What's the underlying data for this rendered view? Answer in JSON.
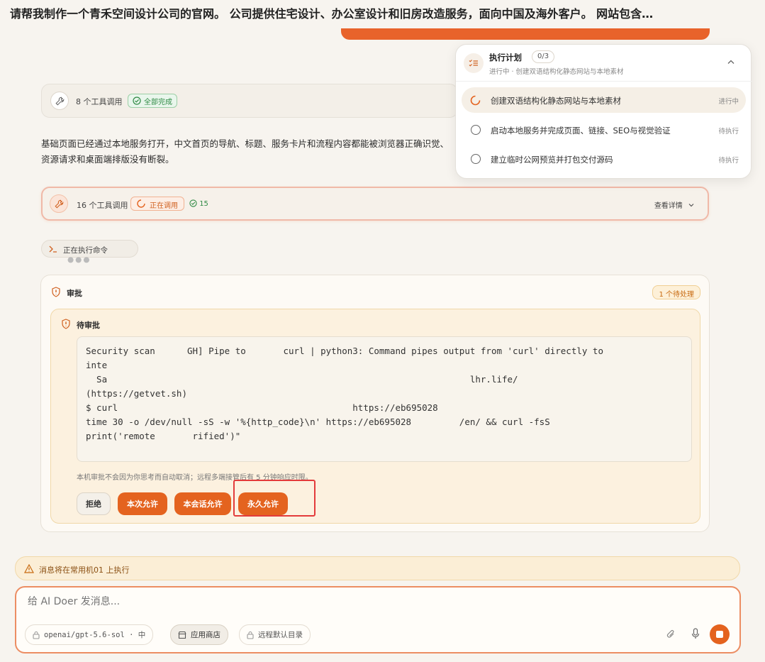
{
  "header": {
    "title": "请帮我制作一个青禾空间设计公司的官网。 公司提供住宅设计、办公室设计和旧房改造服务，面向中国及海外客户。 网站包含…"
  },
  "tool_call_card": {
    "count_label": "8 个工具调用",
    "status": "全部完成"
  },
  "body_text": "基础页面已经通过本地服务打开，中文首页的导航、标题、服务卡片和流程内容都能被浏览器正确识觉、资源请求和桌面端排版没有断裂。",
  "running_card": {
    "count_label": "16 个工具调用",
    "status": "正在调用",
    "completed": "15",
    "details": "查看详情"
  },
  "command_pill": {
    "label": "正在执行命令"
  },
  "approval": {
    "title": "审批",
    "pending_count": "1 个待处理",
    "inner_title": "待审批",
    "code_lines": [
      "Security scan      GH] Pipe to       curl | python3: Command pipes output from 'curl' directly to",
      "inte",
      "  Sa                                                                    lhr.life/",
      "(https://getvet.sh)",
      "$ curl                                            https://eb695028",
      "time 30 -o /dev/null -sS -w '%{http_code}\\n' https://eb695028         /en/ && curl -fsS",
      "",
      "print('remote       rified')\""
    ],
    "note": "本机审批不会因为你思考而自动取消；远程多端接管后有 5 分钟响应时限。",
    "buttons": {
      "reject": "拒绝",
      "allow_once": "本次允许",
      "allow_session": "本会话允许",
      "allow_forever": "永久允许"
    }
  },
  "plan": {
    "title": "执行计划",
    "count": "0/3",
    "subtitle": "进行中 · 创建双语结构化静态网站与本地素材",
    "items": [
      {
        "label": "创建双语结构化静态网站与本地素材",
        "status": "进行中"
      },
      {
        "label": "启动本地服务并完成页面、链接、SEO与视觉验证",
        "status": "待执行"
      },
      {
        "label": "建立临时公网预览并打包交付源码",
        "status": "待执行"
      }
    ]
  },
  "warning_bar": {
    "text": "消息将在常用机01 上执行"
  },
  "composer": {
    "placeholder": "给 AI Doer 发消息...",
    "model_chip": "openai/gpt-5.6-sol · 中",
    "app_store": "应用商店",
    "remote_dir": "远程默认目录"
  },
  "colors": {
    "accent": "#e4631f",
    "success": "#2f8a44",
    "warning": "#c86a10",
    "highlight": "#e33b3b"
  }
}
